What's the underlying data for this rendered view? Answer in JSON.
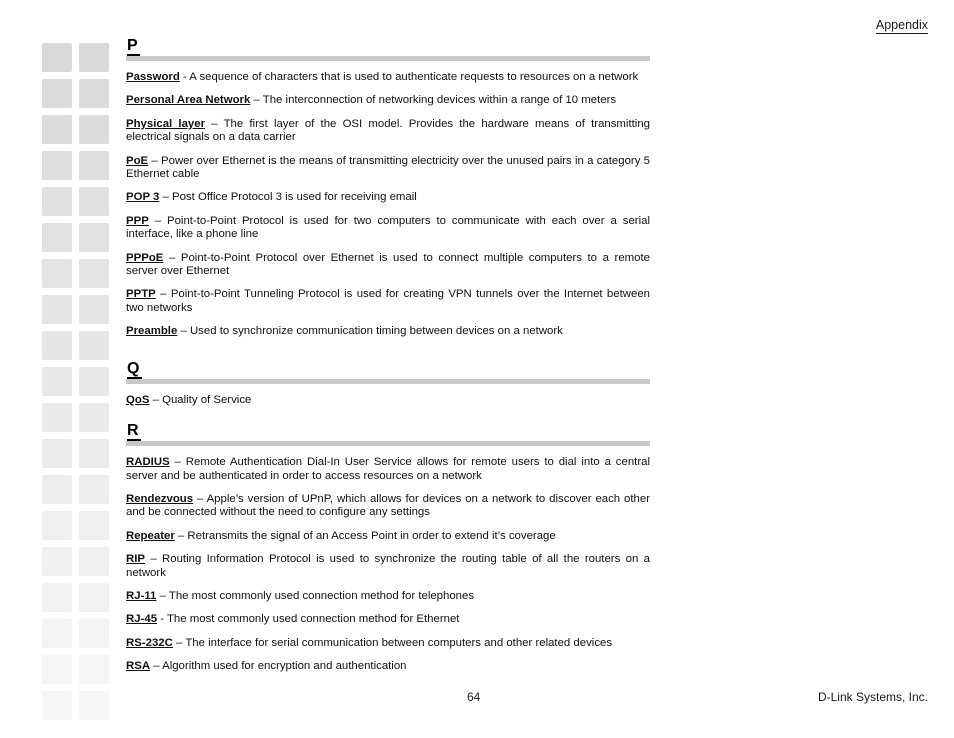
{
  "header": {
    "title": "Appendix"
  },
  "footer": {
    "page_number": "64",
    "company": "D-Link Systems, Inc."
  },
  "thumbnails": {
    "rows": 19,
    "columns": 2,
    "base_color": "#d9d9d9"
  },
  "sections": [
    {
      "letter": "P",
      "entries": [
        {
          "term": "Password",
          "definition": " -  A sequence of characters that is used to authenticate requests to resources on a network"
        },
        {
          "term": "Personal Area Network",
          "definition": " – The interconnection of networking devices within a range of 10 meters"
        },
        {
          "term": "Physical layer",
          "definition": " – The first layer of the OSI model.  Provides the hardware means of transmitting electrical signals on a data carrier"
        },
        {
          "term": "PoE",
          "definition": " – Power over Ethernet is the means of transmitting electricity over the unused pairs in a category 5 Ethernet cable"
        },
        {
          "term": "POP 3",
          "definition": " – Post Office Protocol 3 is used for receiving email"
        },
        {
          "term": "PPP",
          "definition": " – Point-to-Point Protocol is used for two computers to communicate with each over a serial interface, like a phone line"
        },
        {
          "term": "PPPoE",
          "definition": " – Point-to-Point Protocol over Ethernet is used to connect multiple computers to a remote server over Ethernet"
        },
        {
          "term": "PPTP",
          "definition": " – Point-to-Point Tunneling Protocol is used for creating VPN tunnels over the Internet between two networks"
        },
        {
          "term": "Preamble",
          "definition": " – Used to synchronize communication timing between devices on a network"
        }
      ]
    },
    {
      "letter": "Q",
      "entries": [
        {
          "term": "QoS",
          "definition": " – Quality of Service"
        }
      ]
    },
    {
      "letter": "R",
      "entries": [
        {
          "term": "RADIUS",
          "definition": " – Remote Authentication Dial-In User Service allows for remote users to dial into a central server and be authenticated in order to access resources on a network"
        },
        {
          "term": "Rendezvous",
          "definition": " – Apple’s version of UPnP, which allows for devices on a network to discover each other and be connected without the need to configure any settings"
        },
        {
          "term": "Repeater",
          "definition": " – Retransmits the signal of an Access Point in order to extend it’s coverage"
        },
        {
          "term": "RIP",
          "definition": " – Routing Information Protocol is used to synchronize the routing table of all the routers on a network"
        },
        {
          "term": "RJ-11",
          "definition": " – The most commonly used connection method for telephones"
        },
        {
          "term": "RJ-45",
          "definition": " - The most commonly used connection method for Ethernet"
        },
        {
          "term": "RS-232C",
          "definition": " – The interface for serial communication between computers and other related devices"
        },
        {
          "term": "RSA",
          "definition": " – Algorithm used for encryption and authentication"
        }
      ]
    }
  ]
}
